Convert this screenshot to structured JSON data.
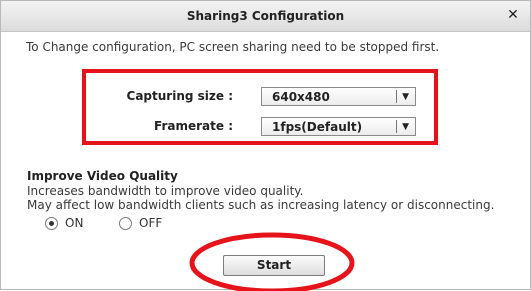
{
  "window": {
    "title": "Sharing3 Configuration",
    "close_glyph": "✕"
  },
  "notice": "To Change configuration, PC screen sharing need to be stopped first.",
  "capture": {
    "label": "Capturing size :",
    "value": "640x480"
  },
  "framerate": {
    "label": "Framerate :",
    "value": "1fps(Default)"
  },
  "quality": {
    "title": "Improve Video Quality",
    "desc_line1": "Increases bandwidth to improve video quality.",
    "desc_line2": "May affect low bandwidth clients such as increasing latency or disconnecting.",
    "on_label": "ON",
    "off_label": "OFF",
    "selected": "ON"
  },
  "start_label": "Start",
  "annotation_color": "#e6131b",
  "icons": {
    "close": "close-icon",
    "dropdown": "chevron-down-icon"
  }
}
